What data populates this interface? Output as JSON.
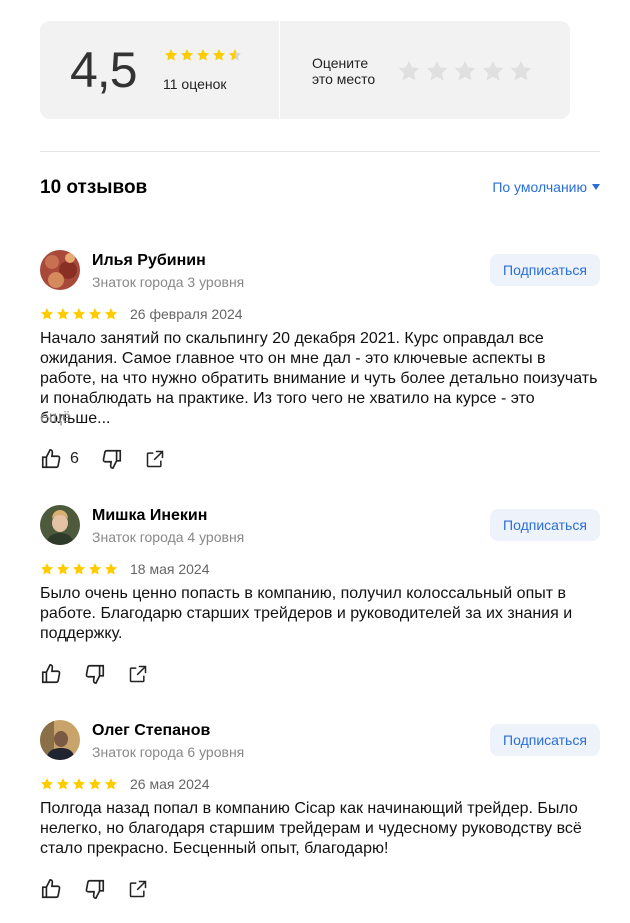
{
  "summary": {
    "score": "4,5",
    "rating": 4.5,
    "ratings_count": "11 оценок",
    "rate_prompt_line1": "Оцените",
    "rate_prompt_line2": "это место"
  },
  "reviews_header": {
    "title": "10 отзывов",
    "sort_label": "По умолчанию"
  },
  "reviews": [
    {
      "author": "Илья Рубинин",
      "level": "Знаток города 3 уровня",
      "subscribe": "Подписаться",
      "rating": 5,
      "date": "26 февраля 2024",
      "text": "Начало занятий по скальпингу 20 декабря 2021. Курс оправдал все ожидания. Самое главное что он мне дал - это ключевые аспекты в работе, на что нужно обратить внимание и чуть более детально поизучать и понаблюдать на практике. Из того чего не хватило на курсе - это больше...",
      "more": "ещё",
      "likes": "6"
    },
    {
      "author": "Мишка Инекин",
      "level": "Знаток города 4 уровня",
      "subscribe": "Подписаться",
      "rating": 5,
      "date": "18 мая 2024",
      "text": "Было очень ценно попасть в компанию, получил колоссальный опыт в работе. Благодарю старших трейдеров и руководителей за их знания и поддержку."
    },
    {
      "author": "Олег Степанов",
      "level": "Знаток города 6 уровня",
      "subscribe": "Подписаться",
      "rating": 5,
      "date": "26 мая 2024",
      "text": "Полгода назад попал в компанию Cicap как начинающий трейдер. Было нелегко, но благодаря старшим трейдерам и чудесному руководству всё стало прекрасно. Бесценный опыт, благодарю!"
    }
  ],
  "colors": {
    "star_filled": "#ffcc00",
    "star_empty": "#e0e0e0",
    "link": "#2a6fd6"
  }
}
